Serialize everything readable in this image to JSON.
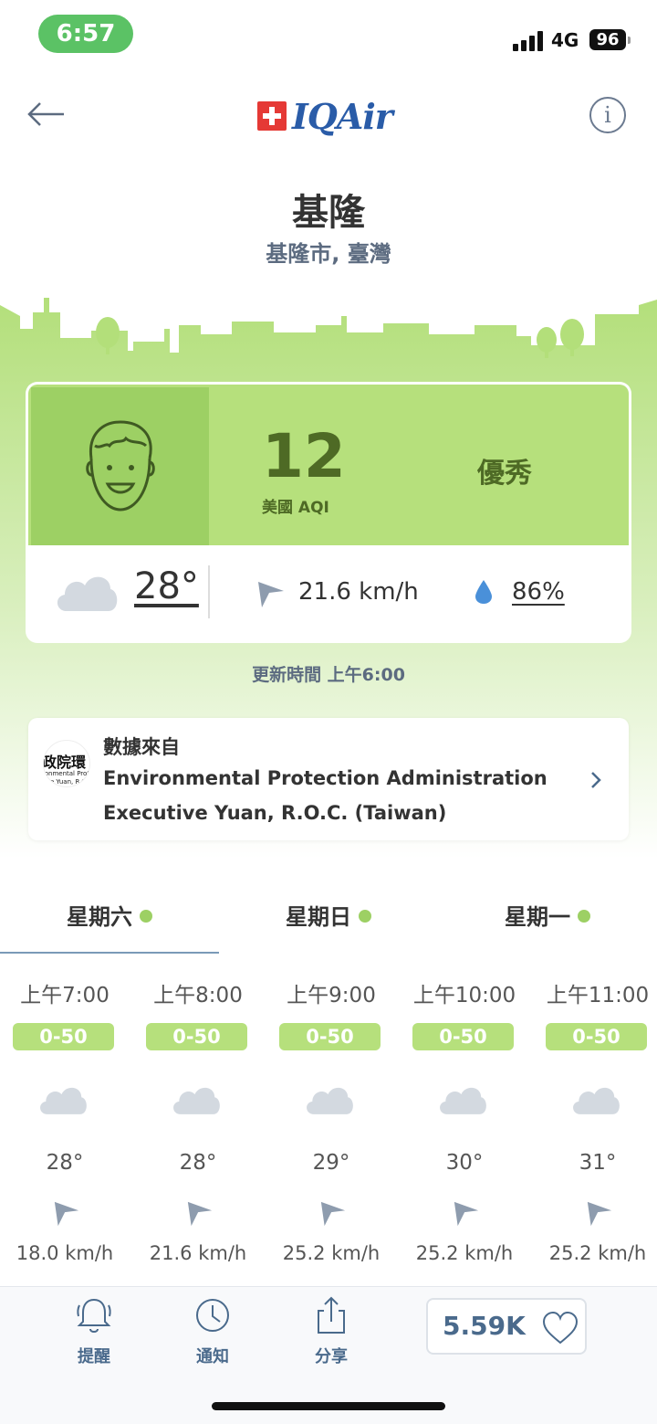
{
  "status_bar": {
    "time": "6:57",
    "network": "4G",
    "battery": "96"
  },
  "header": {
    "logo_text": "IQAir",
    "info_glyph": "i"
  },
  "location": {
    "city": "基隆",
    "region": "基隆市, 臺灣"
  },
  "aqi": {
    "value": "12",
    "label": "美國 AQI",
    "status": "優秀",
    "level_color": "#b6e07c"
  },
  "weather": {
    "temperature": "28°",
    "wind": "21.6 km/h",
    "humidity": "86%",
    "icon": "cloud-icon"
  },
  "updated": "更新時間 上午6:00",
  "source": {
    "title": "數據來自",
    "name_line1": "Environmental Protection Administration",
    "name_line2": "Executive Yuan, R.O.C. (Taiwan)",
    "logo_line1": "政院環",
    "logo_line2": "ronmental Protec",
    "logo_line3": "tive Yuan, R.O."
  },
  "day_tabs": [
    {
      "label": "星期六",
      "active": true
    },
    {
      "label": "星期日",
      "active": false
    },
    {
      "label": "星期一",
      "active": false
    }
  ],
  "hourly": [
    {
      "time": "上午7:00",
      "aqi": "0-50",
      "temp": "28°",
      "wind": "18.0 km/h"
    },
    {
      "time": "上午8:00",
      "aqi": "0-50",
      "temp": "28°",
      "wind": "21.6 km/h"
    },
    {
      "time": "上午9:00",
      "aqi": "0-50",
      "temp": "29°",
      "wind": "25.2 km/h"
    },
    {
      "time": "上午10:00",
      "aqi": "0-50",
      "temp": "30°",
      "wind": "25.2 km/h"
    },
    {
      "time": "上午11:00",
      "aqi": "0-50",
      "temp": "31°",
      "wind": "25.2 km/h"
    }
  ],
  "toolbar": {
    "remind_label": "提醒",
    "notify_label": "通知",
    "share_label": "分享",
    "likes": "5.59K"
  },
  "colors": {
    "good_green": "#b6e07c",
    "face_green": "#9dd064",
    "accent_blue": "#4a6a8c",
    "status_green": "#5bc265"
  }
}
